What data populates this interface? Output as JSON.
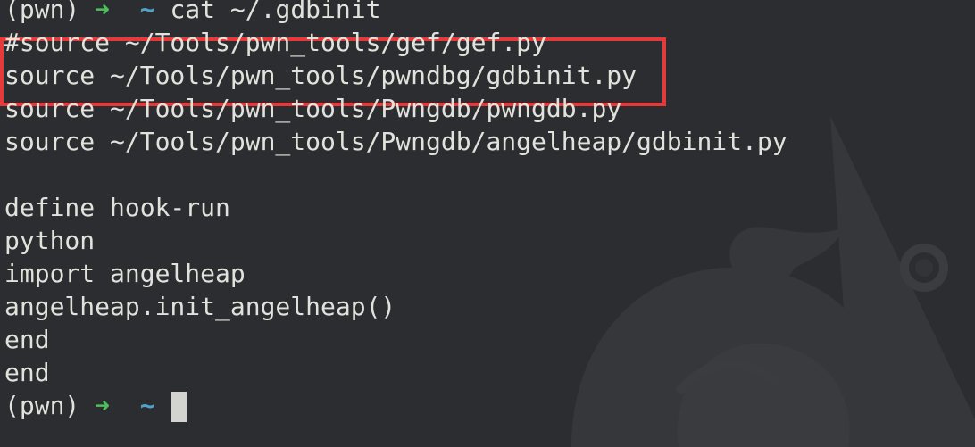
{
  "terminal": {
    "prompt": {
      "env": "(pwn)",
      "arrow": "➜",
      "dir": "~"
    },
    "command": "cat ~/.gdbinit",
    "output": [
      "#source ~/Tools/pwn_tools/gef/gef.py",
      "source ~/Tools/pwn_tools/pwndbg/gdbinit.py",
      "source ~/Tools/pwn_tools/Pwngdb/pwngdb.py",
      "source ~/Tools/pwn_tools/Pwngdb/angelheap/gdbinit.py",
      "",
      "define hook-run",
      "python",
      "import angelheap",
      "angelheap.init_angelheap()",
      "end",
      "end"
    ]
  },
  "colors": {
    "background": "#2c2d30",
    "text": "#e2e2dc",
    "prompt_arrow": "#4fbf5b",
    "prompt_dir": "#4fa3c9",
    "highlight_border": "#e63a3a"
  },
  "icons": [
    "terminal-cursor",
    "wallpaper-dragon-art"
  ]
}
